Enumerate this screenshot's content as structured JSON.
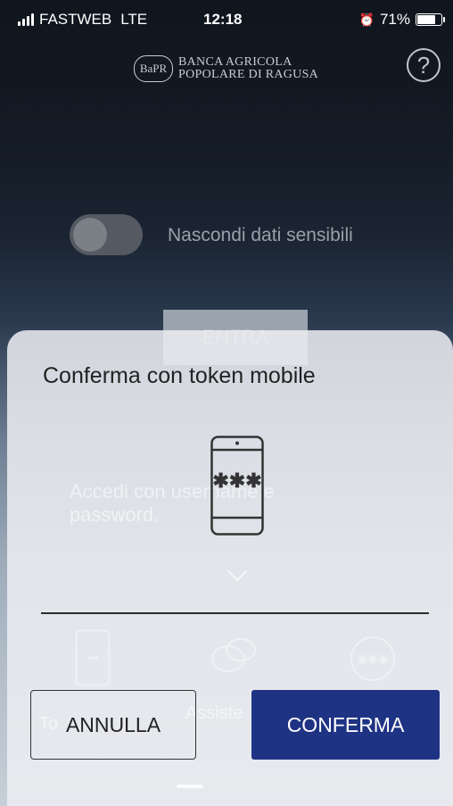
{
  "status_bar": {
    "carrier": "FASTWEB",
    "network": "LTE",
    "time": "12:18",
    "battery": "71%"
  },
  "header": {
    "logo_mark": "BaPR",
    "bank_name_line1": "BANCA AGRICOLA",
    "bank_name_line2": "POPOLARE DI RAGUSA",
    "help_icon": "question-circle-icon"
  },
  "login": {
    "toggle_label": "Nascondi dati sensibili",
    "enter_button": "ENTRA"
  },
  "sheet": {
    "title": "Conferma con token mobile",
    "bg_link_line1": "Accedi con username e",
    "bg_link_line2": "password.",
    "bg_token_label": "To",
    "bg_assist_label": "Assiste",
    "cancel_button": "ANNULLA",
    "confirm_button": "CONFERMA"
  },
  "colors": {
    "accent": "#1f3384"
  }
}
